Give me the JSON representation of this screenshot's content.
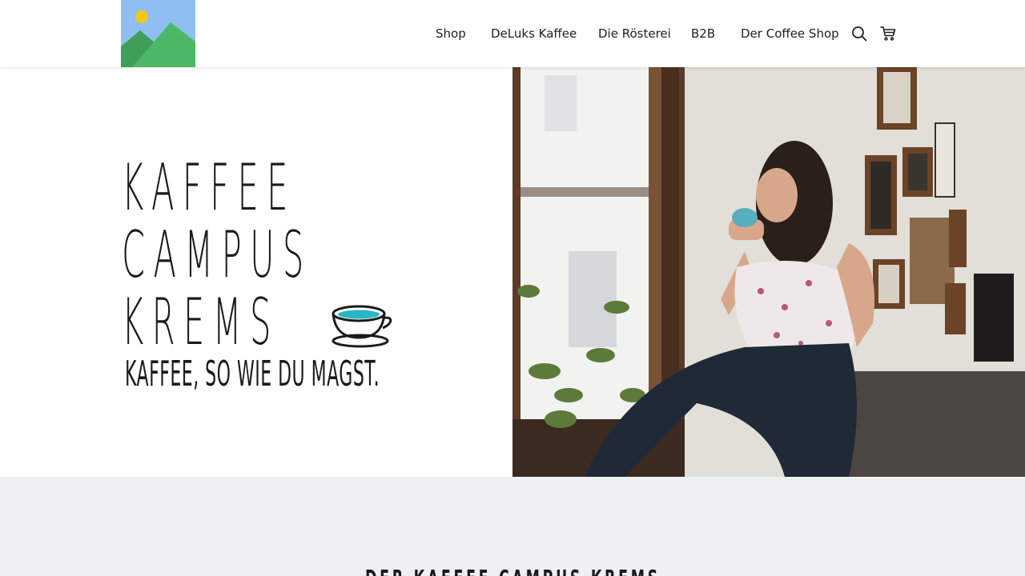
{
  "header": {
    "logo_icon": "image-placeholder-icon",
    "nav": [
      {
        "label": "Shop"
      },
      {
        "label": "DeLuks Kaffee"
      },
      {
        "label": "Die Rösterei"
      },
      {
        "label": "B2B"
      },
      {
        "label": "Der Coffee Shop"
      }
    ],
    "icons": {
      "search": "search-icon",
      "cart": "cart-icon"
    }
  },
  "hero": {
    "brand_lines": [
      "KAFFEE",
      "CAMPUS",
      "KREMS"
    ],
    "tagline": "KAFFEE, SO WIE DU MAGST.",
    "cup_icon": "coffee-cup-icon",
    "photo_alt": "woman-drinking-coffee-photo",
    "colors": {
      "cup_accent": "#2bb6c5"
    }
  },
  "section": {
    "title": "DER KAFFEE CAMPUS KREMS",
    "background": "#eef1f2"
  }
}
